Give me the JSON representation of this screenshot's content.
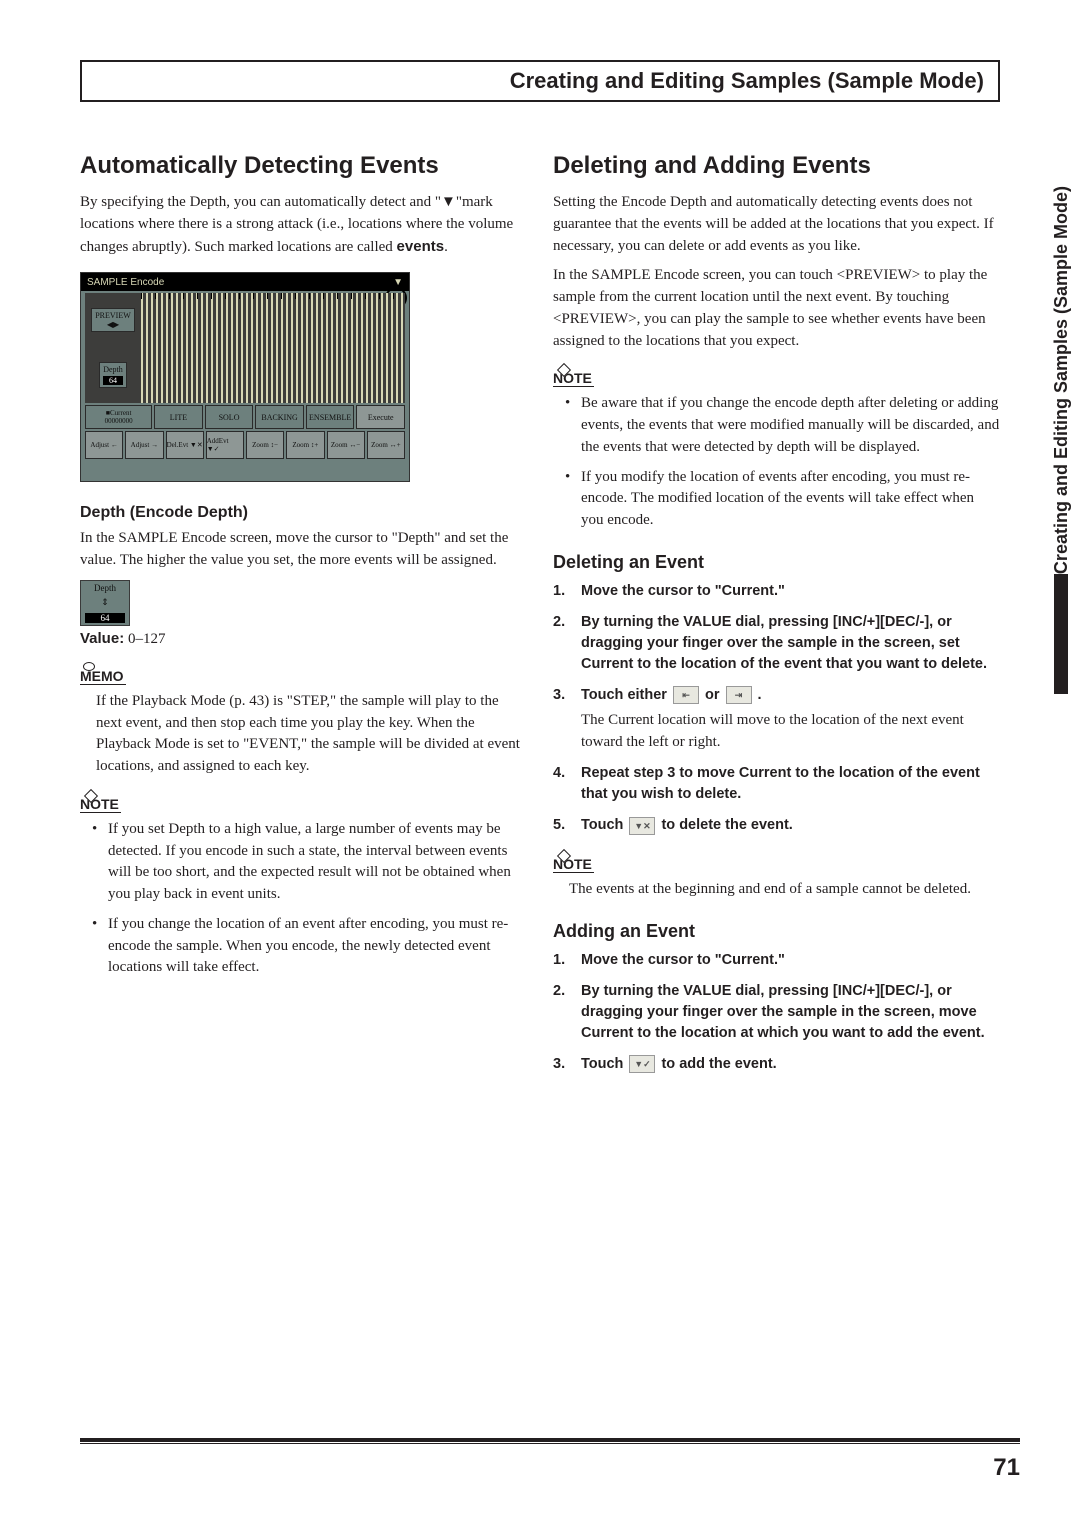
{
  "chapter_title": "Creating and Editing Samples (Sample Mode)",
  "side_tab": "Creating and Editing Samples (Sample Mode)",
  "page_number": "71",
  "left": {
    "h2": "Automatically Detecting Events",
    "intro_1": "By specifying the Depth, you can automatically detect and \"▼\"mark locations where there is a strong attack (i.e., locations where the volume changes abruptly). Such marked locations are called ",
    "intro_1_bold": "events",
    "intro_1_tail": ".",
    "screenshot": {
      "title": "SAMPLE Encode",
      "preview": "PREVIEW",
      "depth_label": "Depth",
      "depth_value": "64",
      "current_label": "■Current",
      "current_value": "00000000",
      "mid": [
        "LITE",
        "SOLO",
        "BACKING",
        "ENSEMBLE",
        "Execute"
      ],
      "bot": [
        "Adjust ←",
        "Adjust →",
        "Del.Evt ▼✕",
        "AddEvt ▼✓",
        "Zoom ↕−",
        "Zoom ↕+",
        "Zoom ↔−",
        "Zoom ↔+"
      ]
    },
    "h4_depth": "Depth (Encode Depth)",
    "depth_para": "In the SAMPLE Encode screen, move the cursor to \"Depth\" and set the value. The higher the value you set, the more events will be assigned.",
    "depth_thumb_label": "Depth",
    "depth_thumb_value": "64",
    "value_label": "Value:",
    "value_range": " 0–127",
    "memo_label": "MEMO",
    "memo_text": "If the Playback Mode (p. 43) is \"STEP,\" the sample will play to the next event, and then stop each time you play the key. When the Playback Mode is set to \"EVENT,\" the sample will be divided at event locations, and assigned to each key.",
    "note_label": "NOTE",
    "note_b1": "If you set Depth to a high value, a large number of events may be detected. If you encode in such a state, the interval between events will be too short, and the expected result will not be obtained when you play back in event units.",
    "note_b2": "If you change the location of an event after encoding, you must re-encode the sample. When you encode, the newly detected event locations will take effect."
  },
  "right": {
    "h2": "Deleting and Adding Events",
    "p1": "Setting the Encode Depth and automatically detecting events does not guarantee that the events will be added at the locations that you expect. If necessary, you can delete or add events as you like.",
    "p2": "In the SAMPLE Encode screen, you can touch <PREVIEW> to play the sample from the current location until the next event. By touching <PREVIEW>, you can play the sample to see whether events have been assigned to the locations that you expect.",
    "note_label": "NOTE",
    "note_b1": "Be aware that if you change the encode depth after deleting or adding events, the events that were modified manually will be discarded, and the events that were detected by depth will be displayed.",
    "note_b2": "If you modify the location of events after encoding, you must re-encode. The modified location of the events will take effect when you encode.",
    "del_h3": "Deleting an Event",
    "del_s1": "Move the cursor to \"Current.\"",
    "del_s2": "By turning the VALUE dial, pressing [INC/+][DEC/-], or dragging your finger over the sample in the screen, set Current to the location of the event that you want to delete.",
    "del_s3a": "Touch either ",
    "del_s3b": " or ",
    "del_s3c": " .",
    "del_s3_sub": "The Current location will move to the location of the next event toward the left or right.",
    "del_s4": "Repeat step 3 to move Current to the location of the event that you wish to delete.",
    "del_s5a": "Touch ",
    "del_s5b": " to delete the event.",
    "del_note_label": "NOTE",
    "del_note": "The events at the beginning and end of a sample cannot be deleted.",
    "add_h3": "Adding an Event",
    "add_s1": "Move the cursor to \"Current.\"",
    "add_s2": "By turning the VALUE dial, pressing [INC/+][DEC/-], or dragging your finger over the sample in the screen, move Current to the location at which you want to add the event.",
    "add_s3a": "Touch ",
    "add_s3b": " to add the event."
  }
}
